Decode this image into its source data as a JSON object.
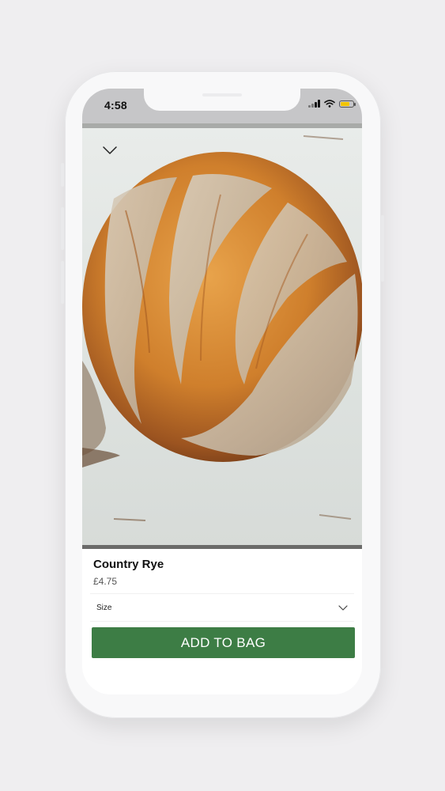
{
  "status_bar": {
    "time": "4:58"
  },
  "product": {
    "name": "Country Rye",
    "price": "£4.75",
    "image_icon": "bread-loaf-photo"
  },
  "options": {
    "size_label": "Size"
  },
  "actions": {
    "add_to_bag_label": "ADD TO BAG"
  },
  "colors": {
    "accent": "#3d7d45",
    "battery": "#f2c400"
  }
}
